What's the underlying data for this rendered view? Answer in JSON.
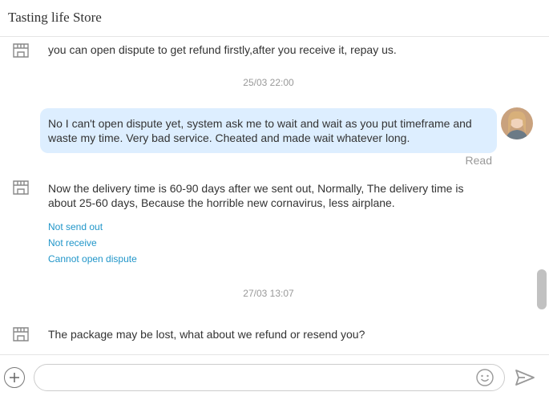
{
  "header": {
    "title": "Tasting life Store"
  },
  "messages": {
    "m1": "you can open dispute to get refund firstly,after you receive it, repay us.",
    "ts1": "25/03 22:00",
    "user_msg": "No I can't open dispute yet, system ask me to wait and wait as you put timeframe and waste my time. Very bad service. Cheated and made wait whatever long.",
    "read_status": "Read",
    "m2": "Now the delivery time is 60-90 days after we sent out, Normally, The delivery time is about 25-60 days, Because the horrible new cornavirus, less airplane.",
    "quick_links": [
      "Not send out",
      "Not receive",
      "Cannot open dispute"
    ],
    "ts2": "27/03 13:07",
    "m3": "The package may be lost, what about we refund or resend you?"
  },
  "composer": {
    "placeholder": ""
  },
  "icons": {
    "store": "store-icon",
    "plus": "plus-icon",
    "emoji": "emoji-icon",
    "send": "send-icon"
  },
  "colors": {
    "user_bubble": "#ddeeff",
    "link": "#2196c9",
    "muted": "#999999"
  }
}
